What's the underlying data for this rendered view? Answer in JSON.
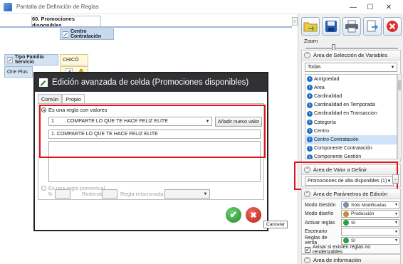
{
  "window": {
    "title": "Pantalla de Definición de Reglas",
    "controls": [
      "—",
      "☐",
      "✕"
    ]
  },
  "document_tab": {
    "label": "60. Promociones disponibles"
  },
  "grid": {
    "column_header": "Centro Contratación",
    "row_header": "Tipo Familia Servicio",
    "row_label": "One Plus",
    "cell_value": "CHICÓ"
  },
  "dialog": {
    "title": "Edición avanzada de celda (Promociones disponibles)",
    "tabs": [
      "Común",
      "Propio"
    ],
    "rule_radio": "Es una regla con valores",
    "rule_number": "1",
    "rule_combo_value": ". COMPARTE LO QUE TE HACE FELIZ ELITE",
    "add_value_button": "Añadir nuevo valor",
    "rule_text": "1. COMPARTE LO QUE TE HACE FELIZ ELITE",
    "percent_radio": "Es una regla porcentual",
    "percent_label": "%",
    "rounding_label": "Redondeo",
    "related_rule_label": "Regla relacionada",
    "ok_glyph": "✔",
    "cancel_glyph": "✖",
    "cancel_tooltip": "Cancelar"
  },
  "right_panel": {
    "zoom_label": "Zoom",
    "variables_section": "Área de Selección de Variables",
    "variables_filter": "Todas",
    "variables": [
      "Antigüedad",
      "Area",
      "Cardinalidad",
      "Cardinalidad en Temporada",
      "Cardinalidad en Transaccion",
      "Categoría",
      "Centro",
      "Centro Contratación",
      "Componente Contratación",
      "Componente Gestión"
    ],
    "selected_variable": "Centro Contratación",
    "value_section": "Área de Valor a Definir",
    "value_combo": "Promociones de alta disponibles (1)",
    "params_section": "Área de Parámetros de Edición",
    "params": [
      {
        "label": "Modo Gestión",
        "value": "Sólo Modificadas",
        "icon": "gear-icon"
      },
      {
        "label": "Modo diseño",
        "value": "Producción",
        "icon": "factory-icon"
      },
      {
        "label": "Activar reglas",
        "value": "SI",
        "icon": "check-icon"
      },
      {
        "label": "Escenario",
        "value": "",
        "icon": ""
      },
      {
        "label": "Reglas de venta",
        "value": "SI",
        "icon": "check-icon"
      }
    ],
    "non_renderable_checkbox": "Avisar si existen reglas no renderizables",
    "info_section": "Área de información"
  },
  "colors": {
    "highlight_red": "#e0141e",
    "dialog_title_bg": "#2f3134",
    "ok_green": "#2ea043",
    "cancel_red": "#d9302c",
    "selected_row": "#cfe3f9"
  }
}
